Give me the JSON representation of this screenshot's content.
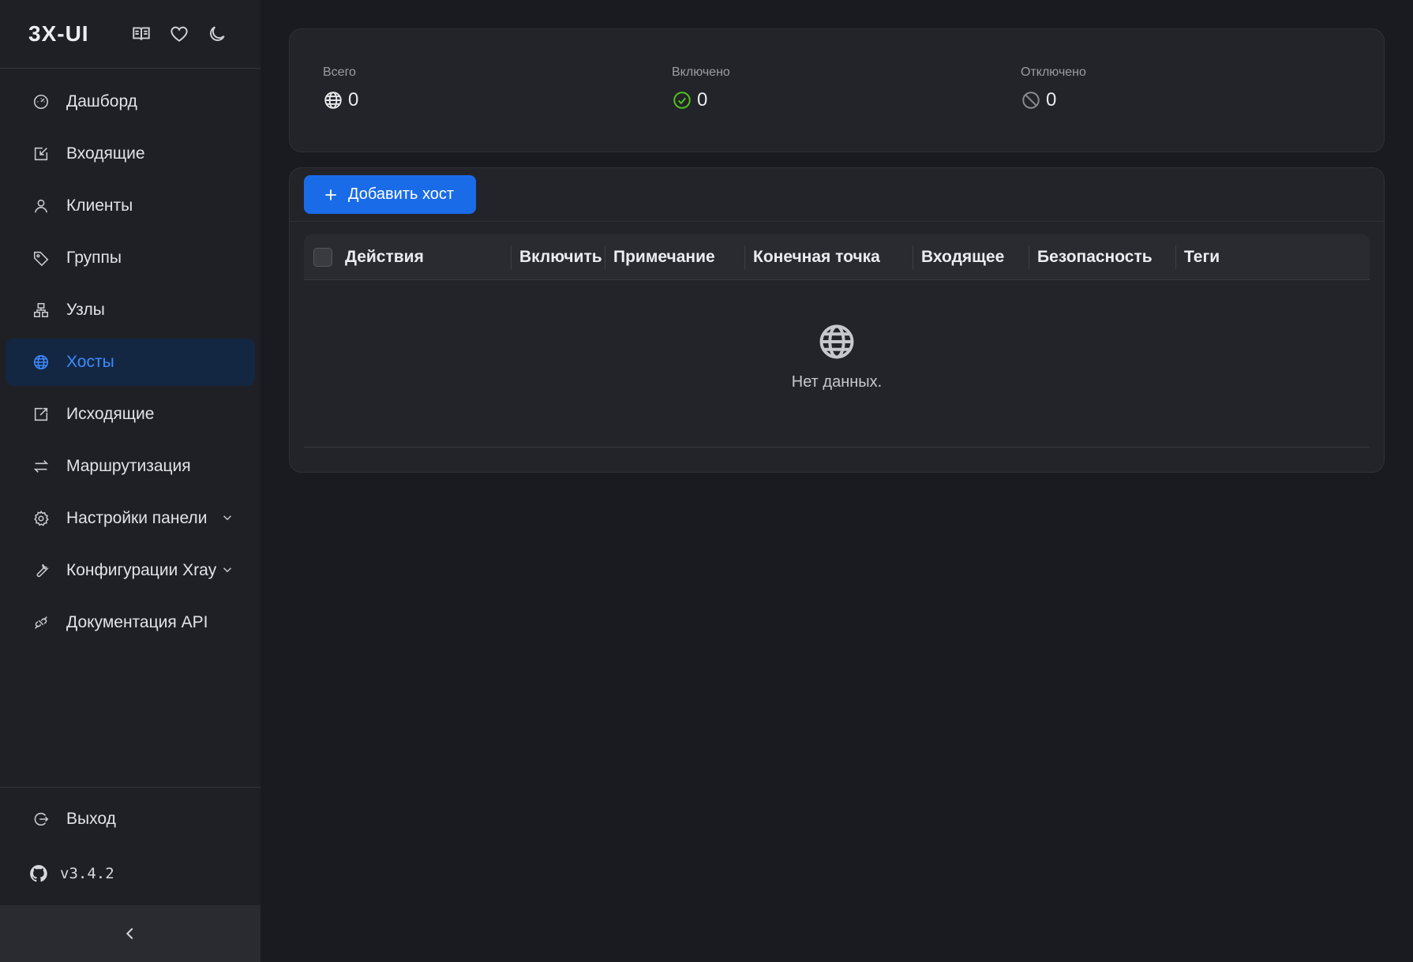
{
  "brand": {
    "title": "3X-UI"
  },
  "header_icons": [
    "book-icon",
    "heart-icon",
    "moon-icon"
  ],
  "sidebar": {
    "items": [
      {
        "label": "Дашборд",
        "icon": "dashboard-icon"
      },
      {
        "label": "Входящие",
        "icon": "inbound-icon"
      },
      {
        "label": "Клиенты",
        "icon": "clients-icon"
      },
      {
        "label": "Группы",
        "icon": "tag-icon"
      },
      {
        "label": "Узлы",
        "icon": "nodes-icon"
      },
      {
        "label": "Хосты",
        "icon": "globe-icon",
        "active": true
      },
      {
        "label": "Исходящие",
        "icon": "outbound-icon"
      },
      {
        "label": "Маршрутизация",
        "icon": "routing-icon"
      },
      {
        "label": "Настройки панели",
        "icon": "gear-icon",
        "expandable": true
      },
      {
        "label": "Конфигурации Xray",
        "icon": "wrench-icon",
        "expandable": true
      },
      {
        "label": "Документация API",
        "icon": "api-icon"
      }
    ],
    "logout_label": "Выход",
    "version": "v3.4.2"
  },
  "stats": {
    "total_label": "Всего",
    "total_value": "0",
    "enabled_label": "Включено",
    "enabled_value": "0",
    "disabled_label": "Отключено",
    "disabled_value": "0"
  },
  "colors": {
    "accent": "#1a6be8",
    "active_text": "#3d8bff",
    "enabled_green": "#52c41a"
  },
  "toolbar": {
    "add_host_label": "Добавить хост"
  },
  "table": {
    "columns": [
      "Действия",
      "Включить",
      "Примечание",
      "Конечная точка",
      "Входящее",
      "Безопасность",
      "Теги"
    ],
    "empty_text": "Нет данных."
  }
}
